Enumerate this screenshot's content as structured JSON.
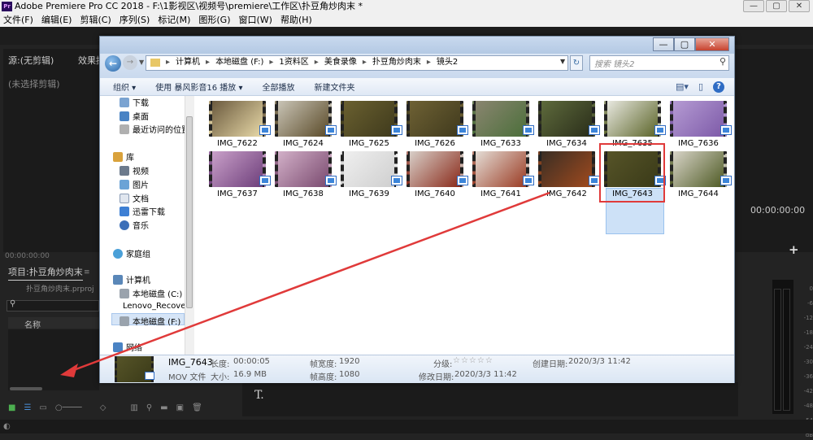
{
  "premiere": {
    "logo_text": "Pr",
    "title": "Adobe Premiere Pro CC 2018 - F:\\1影视区\\视频号\\premiere\\工作区\\扑豆角炒肉末 *",
    "window_buttons": [
      "—",
      "▢",
      "✕"
    ],
    "menu": [
      "文件(F)",
      "编辑(E)",
      "剪辑(C)",
      "序列(S)",
      "标记(M)",
      "图形(G)",
      "窗口(W)",
      "帮助(H)"
    ],
    "source_title": "源:(无剪辑)",
    "effects_title": "效果控",
    "no_clip": "(未选择剪辑)",
    "source_timecode": "00:00:00:00",
    "program_timecode": "00:00:00:00",
    "plus": "+",
    "project_title": "项目:扑豆角炒肉末",
    "project_menu": "≡",
    "project_file": "扑豆角炒肉末.prproj",
    "column_name": "名称",
    "type_tool": "T.",
    "meter_labels": [
      "0",
      "-6",
      "-12",
      "-18",
      "-24",
      "-30",
      "-36",
      "-42",
      "-48",
      "-54",
      "dB"
    ]
  },
  "explorer": {
    "window_buttons": {
      "minimize": "—",
      "maximize": "▢",
      "close": "✕"
    },
    "address": [
      "计算机",
      "本地磁盘 (F:)",
      "1资料区",
      "美食录像",
      "扑豆角炒肉末",
      "镜头2"
    ],
    "search_placeholder": "搜索 镜头2",
    "toolbar": {
      "organize": "组织 ▾",
      "play_with": "使用 暴风影音16 播放 ▾",
      "play_all": "全部播放",
      "new_folder": "新建文件夹"
    },
    "nav": {
      "downloads": "下载",
      "desktop": "桌面",
      "recent": "最近访问的位置",
      "library": "库",
      "videos": "视频",
      "pictures": "图片",
      "documents": "文档",
      "thunder": "迅雷下载",
      "music": "音乐",
      "homegroup": "家庭组",
      "computer": "计算机",
      "disk_c": "本地磁盘 (C:)",
      "lenovo": "Lenovo_Recove",
      "disk_f": "本地磁盘 (F:)",
      "network": "网络"
    },
    "files": [
      {
        "name": "IMG_7622",
        "c1": "#6b5a3e",
        "c2": "#e8d9a8"
      },
      {
        "name": "IMG_7624",
        "c1": "#c9c4b6",
        "c2": "#5a4a28"
      },
      {
        "name": "IMG_7625",
        "c1": "#6a6030",
        "c2": "#3f3a1c"
      },
      {
        "name": "IMG_7626",
        "c1": "#6e6134",
        "c2": "#403a1d"
      },
      {
        "name": "IMG_7633",
        "c1": "#8a8570",
        "c2": "#4b6f3a"
      },
      {
        "name": "IMG_7634",
        "c1": "#5e6a3c",
        "c2": "#2a2e1a"
      },
      {
        "name": "IMG_7635",
        "c1": "#e8e8e0",
        "c2": "#5b6428"
      },
      {
        "name": "IMG_7636",
        "c1": "#b59bd3",
        "c2": "#7d5aa8"
      },
      {
        "name": "IMG_7637",
        "c1": "#c9a0c9",
        "c2": "#6d3e7a"
      },
      {
        "name": "IMG_7638",
        "c1": "#d2b0c8",
        "c2": "#7a4a6f"
      },
      {
        "name": "IMG_7639",
        "c1": "#efefef",
        "c2": "#cfcfcf"
      },
      {
        "name": "IMG_7640",
        "c1": "#d8cfc8",
        "c2": "#8a2a1a"
      },
      {
        "name": "IMG_7641",
        "c1": "#e4ddd6",
        "c2": "#9a3a22"
      },
      {
        "name": "IMG_7642",
        "c1": "#3a2e24",
        "c2": "#a04a1e"
      },
      {
        "name": "IMG_7643",
        "c1": "#565428",
        "c2": "#3a3a18"
      },
      {
        "name": "IMG_7644",
        "c1": "#d8d4c8",
        "c2": "#4e5a24"
      }
    ],
    "details": {
      "name": "IMG_7643",
      "type": "MOV 文件",
      "length_label": "长度:",
      "length": "00:00:05",
      "size_label": "大小:",
      "size": "16.9 MB",
      "width_label": "帧宽度:",
      "width": "1920",
      "height_label": "帧高度:",
      "height": "1080",
      "rating_label": "分级:",
      "stars": "☆☆☆☆☆",
      "modified_label": "修改日期:",
      "modified": "2020/3/3 11:42",
      "created_label": "创建日期:",
      "created": "2020/3/3 11:42"
    }
  },
  "colors": {
    "annotation_red": "#e03a3a",
    "selection_blue": "#cde1f7"
  }
}
